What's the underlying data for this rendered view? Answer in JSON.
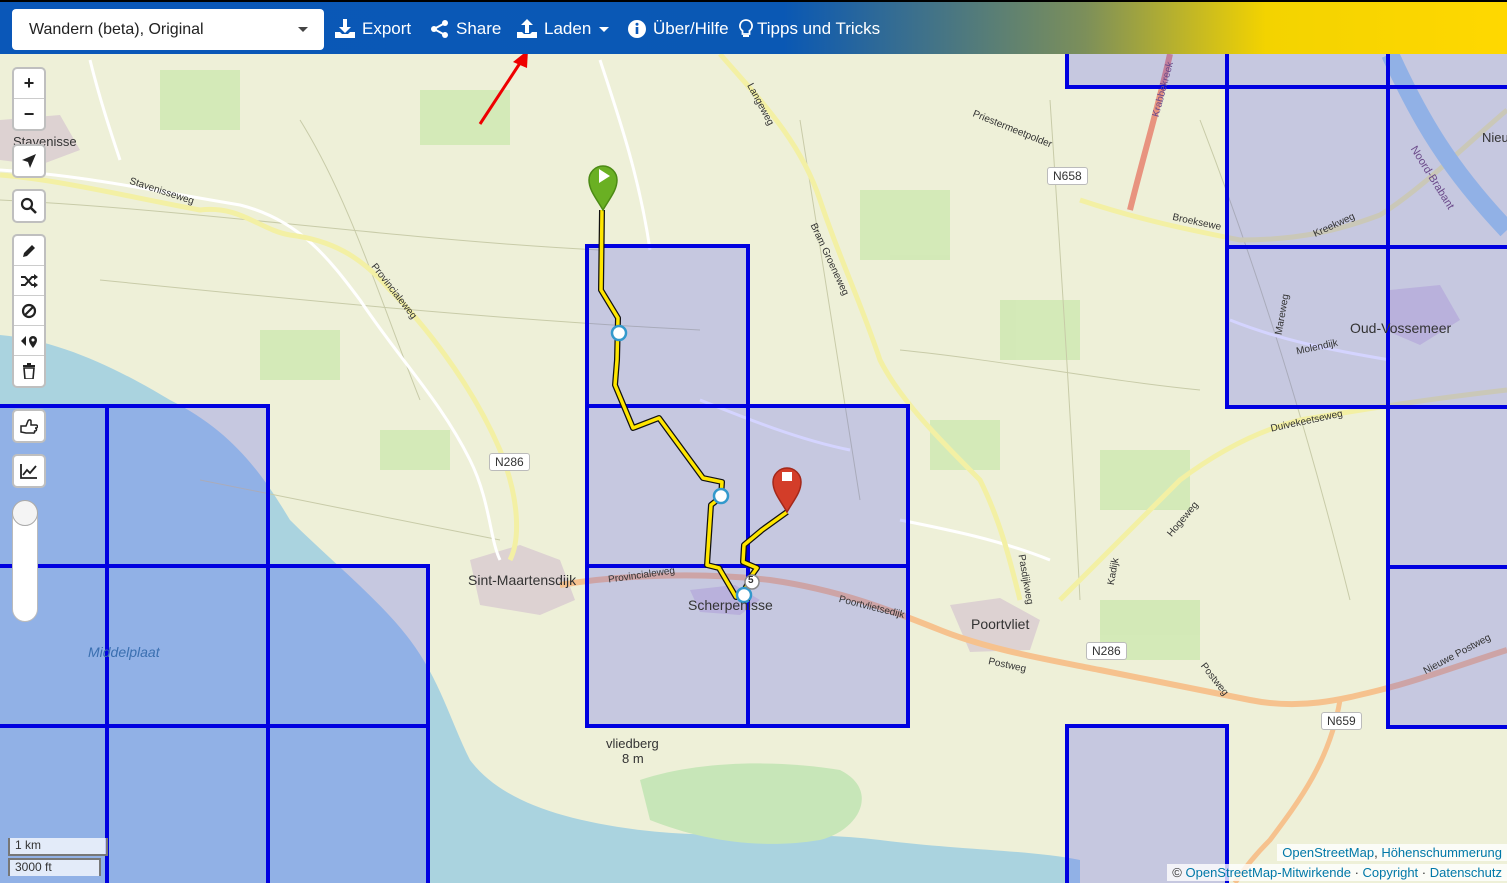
{
  "toolbar": {
    "profile": "Wandern (beta), Original",
    "export": "Export",
    "share": "Share",
    "load": "Laden",
    "about": "Über/Hilfe",
    "tips": "Tipps und Tricks",
    "accent_blue": "#0a57b8",
    "accent_yellow": "#ffd800"
  },
  "controls": {
    "zoom_in": "+",
    "zoom_out": "−",
    "icons": [
      "locate-icon",
      "search-icon",
      "draw-icon",
      "shuffle-icon",
      "block-icon",
      "reverse-route-icon",
      "delete-icon",
      "hand-pointer-icon",
      "elevation-chart-icon"
    ]
  },
  "map": {
    "places": {
      "stavenisse": "Stavenisse",
      "sint_maartensdijk": "Sint-Maartensdijk",
      "scherpenisse": "Scherpenisse",
      "poortvliet": "Poortvliet",
      "oud_vossemeer": "Oud-Vossemeer",
      "middelplaat": "Middelplaat",
      "vliedberg": "vliedberg",
      "vliedberg_height": "8 m",
      "niew": "Nieu",
      "noord_brabant": "Noord-Brabant"
    },
    "roads": {
      "stavenisseweg": "Stavenisseweg",
      "provincialeweg": "Provincialeweg",
      "langeweg": "Langeweg",
      "priestermeetpolder": "Priestermeetpolder",
      "bram_groeneweg": "Bram Groeneweg",
      "broeksewe": "Broeksewe",
      "kreekweg": "Kreekweg",
      "krabbekreek": "Krabbekreek",
      "duivekeetseweg": "Duivekeetseweg",
      "hogeweg": "Hogeweg",
      "postweg": "Postweg",
      "poortvlietsedijk": "Poortvlietsedijk",
      "molendijk": "Molendijk",
      "mareweg": "Mareweg",
      "nieuwe_postweg": "Nieuwe Postweg",
      "kadijk": "Kadijk",
      "pasdijk": "Pasdijkweg"
    },
    "badges": {
      "n658": "N658",
      "n286_west": "N286",
      "n286_east": "N286",
      "n659": "N659"
    },
    "waypoint_number": "5",
    "route_color": "#ffe600",
    "tile_color": "#0000e0"
  },
  "scale": {
    "metric": "1 km",
    "imperial": "3000 ft"
  },
  "attribution": {
    "osm": "OpenStreetMap",
    "sep": ", ",
    "hillshade": "Höhenschummerung",
    "copy": "© ",
    "contributors": "OpenStreetMap-Mitwirkende",
    "dot1": " · ",
    "copyright": "Copyright",
    "dot2": " · ",
    "privacy": "Datenschutz"
  }
}
